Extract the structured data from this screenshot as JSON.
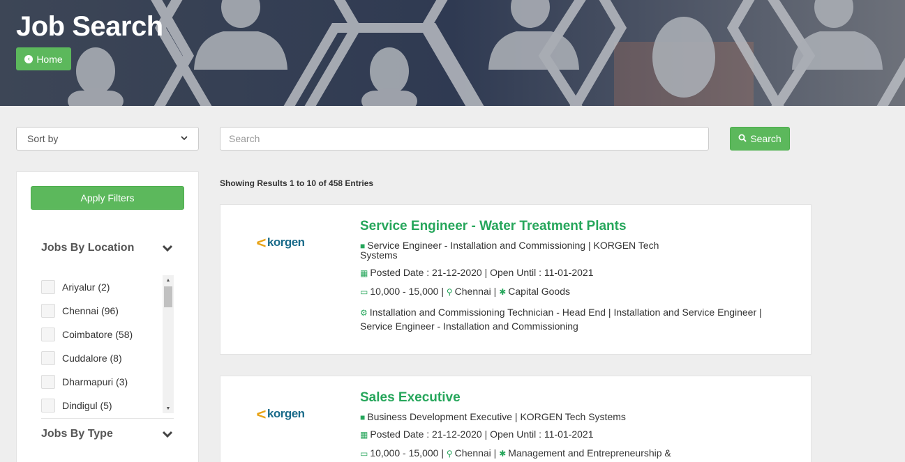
{
  "header": {
    "title": "Job Search",
    "home_label": "Home"
  },
  "toolbar": {
    "sort_label": "Sort by",
    "search_placeholder": "Search",
    "search_button": "Search"
  },
  "sidebar": {
    "apply_label": "Apply Filters",
    "location_heading": "Jobs By Location",
    "type_heading": "Jobs By Type",
    "locations": [
      {
        "label": "Ariyalur (2)"
      },
      {
        "label": "Chennai (96)"
      },
      {
        "label": "Coimbatore (58)"
      },
      {
        "label": "Cuddalore (8)"
      },
      {
        "label": "Dharmapuri (3)"
      },
      {
        "label": "Dindigul (5)"
      }
    ]
  },
  "results": {
    "summary": "Showing Results 1 to 10 of 458 Entries",
    "jobs": [
      {
        "logo_text": "korgen",
        "title": "Service Engineer - Water Treatment Plants",
        "role_line1": "Service Engineer - Installation and Commissioning | KORGEN Tech",
        "role_line2": "Systems",
        "dates": "Posted Date : 21-12-2020 | Open Until : 11-01-2021",
        "salary": "10,000 - 15,000 |",
        "location": "Chennai |",
        "industry": "Capital Goods",
        "skills_line1": "Installation and Commissioning Technician - Head End   | Installation and Service Engineer |",
        "skills_line2": "Service Engineer - Installation and Commissioning"
      },
      {
        "logo_text": "korgen",
        "title": "Sales Executive",
        "role_line1": "Business Development Executive | KORGEN Tech Systems",
        "dates": "Posted Date : 21-12-2020 | Open Until : 11-01-2021",
        "salary": "10,000 - 15,000 |",
        "location": "Chennai |",
        "industry": "Management and Entrepreneurship &"
      }
    ]
  },
  "colors": {
    "accent": "#5cb85c",
    "title_green": "#26a65b",
    "page_bg": "#eeeeee"
  }
}
